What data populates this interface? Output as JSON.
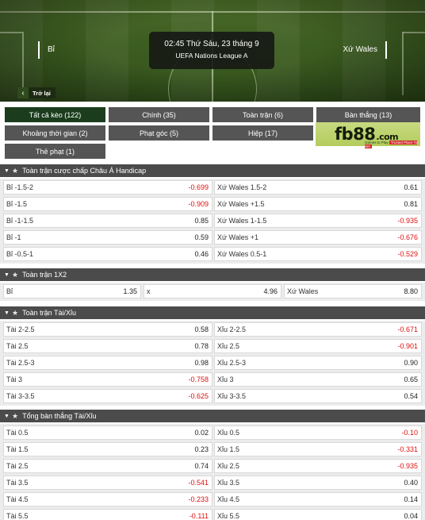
{
  "header": {
    "home_team": "Bỉ",
    "away_team": "Xứ Wales",
    "match_time": "02:45 Thứ Sáu, 23 tháng 9",
    "league": "UEFA Nations League A",
    "back_label": "Trở lại"
  },
  "filters": [
    "Tất cả kèo (122)",
    "Chính (35)",
    "Toàn trận (6)",
    "Bàn thắng (13)",
    "Khoảng thời gian (2)",
    "Phạt góc (5)",
    "Hiệp (17)",
    "Thẻ phạt (1)"
  ],
  "filter_active": "Tất cả kèo (122)",
  "ad": {
    "brand": "fb88",
    "domain": ".com",
    "tagline_left": "Games to Play",
    "tagline_right": "Trusted Place To Bet"
  },
  "sections": [
    {
      "title": "Toàn trận cược chấp Châu Á Handicap",
      "rows": [
        [
          {
            "l": "Bỉ -1.5-2",
            "r": "-0.699"
          },
          {
            "l": "Xứ Wales 1.5-2",
            "r": "0.61"
          }
        ],
        [
          {
            "l": "Bỉ -1.5",
            "r": "-0.909"
          },
          {
            "l": "Xứ Wales +1.5",
            "r": "0.81"
          }
        ],
        [
          {
            "l": "Bỉ -1-1.5",
            "r": "0.85"
          },
          {
            "l": "Xứ Wales 1-1.5",
            "r": "-0.935"
          }
        ],
        [
          {
            "l": "Bỉ -1",
            "r": "0.59"
          },
          {
            "l": "Xứ Wales +1",
            "r": "-0.676"
          }
        ],
        [
          {
            "l": "Bỉ -0.5-1",
            "r": "0.46"
          },
          {
            "l": "Xứ Wales 0.5-1",
            "r": "-0.529"
          }
        ]
      ]
    },
    {
      "title": "Toàn trận 1X2",
      "rows": [
        [
          {
            "l": "Bỉ",
            "r": "1.35"
          },
          {
            "l": "x",
            "r": "4.96"
          },
          {
            "l": "Xứ Wales",
            "r": "8.80"
          }
        ]
      ]
    },
    {
      "title": "Toàn trận Tài/Xỉu",
      "rows": [
        [
          {
            "l": "Tài 2-2.5",
            "r": "0.58"
          },
          {
            "l": "Xỉu 2-2.5",
            "r": "-0.671"
          }
        ],
        [
          {
            "l": "Tài 2.5",
            "r": "0.78"
          },
          {
            "l": "Xỉu 2.5",
            "r": "-0.901"
          }
        ],
        [
          {
            "l": "Tài 2.5-3",
            "r": "0.98"
          },
          {
            "l": "Xỉu 2.5-3",
            "r": "0.90"
          }
        ],
        [
          {
            "l": "Tài 3",
            "r": "-0.758"
          },
          {
            "l": "Xỉu 3",
            "r": "0.65"
          }
        ],
        [
          {
            "l": "Tài 3-3.5",
            "r": "-0.625"
          },
          {
            "l": "Xỉu 3-3.5",
            "r": "0.54"
          }
        ]
      ]
    },
    {
      "title": "Tổng bàn thắng Tài/Xỉu",
      "rows": [
        [
          {
            "l": "Tài 0.5",
            "r": "0.02"
          },
          {
            "l": "Xỉu 0.5",
            "r": "-0.10"
          }
        ],
        [
          {
            "l": "Tài 1.5",
            "r": "0.23"
          },
          {
            "l": "Xỉu 1.5",
            "r": "-0.331"
          }
        ],
        [
          {
            "l": "Tài 2.5",
            "r": "0.74"
          },
          {
            "l": "Xỉu 2.5",
            "r": "-0.935"
          }
        ],
        [
          {
            "l": "Tài 3.5",
            "r": "-0.541"
          },
          {
            "l": "Xỉu 3.5",
            "r": "0.40"
          }
        ],
        [
          {
            "l": "Tài 4.5",
            "r": "-0.233"
          },
          {
            "l": "Xỉu 4.5",
            "r": "0.14"
          }
        ],
        [
          {
            "l": "Tài 5.5",
            "r": "-0.111"
          },
          {
            "l": "Xỉu 5.5",
            "r": "0.04"
          }
        ]
      ]
    }
  ],
  "colors": {
    "header_bar": "#4b4b4b",
    "filter_button": "#555555",
    "filter_active": "#1b3d1d",
    "negative_odds": "#e01010",
    "pitch_green": "#3d5e21"
  }
}
